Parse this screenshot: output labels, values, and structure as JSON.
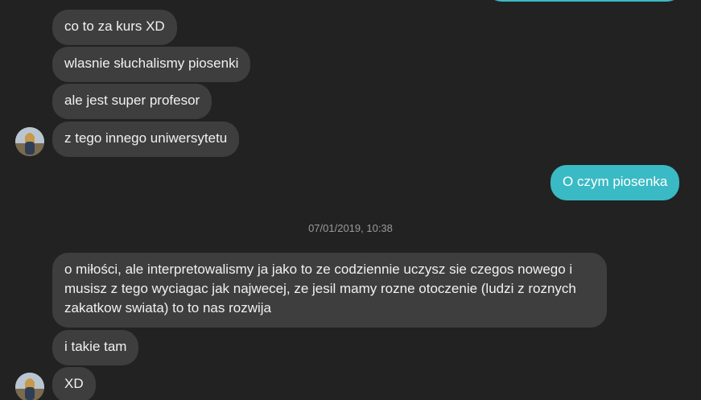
{
  "conversation": {
    "received": [
      "co to za kurs XD",
      "wlasnie słuchalismy piosenki",
      "ale jest super profesor",
      "z tego innego uniwersytetu"
    ],
    "sent": [
      "O czym piosenka"
    ],
    "timestamp": "07/01/2019, 10:38",
    "received_after": [
      "o miłości, ale interpretowalismy ja jako to ze codziennie uczysz sie czegos nowego i musisz z tego wyciagac jak najwecej, ze jesil mamy rozne otoczenie (ludzi z roznych zakatkow swiata) to to nas rozwija",
      "i takie tam",
      "XD"
    ]
  },
  "colors": {
    "background": "#222222",
    "incoming_bubble": "#3e3e3e",
    "outgoing_bubble": "#3abac4",
    "timestamp_text": "#9a9a9a"
  },
  "icons": [
    "contact-avatar",
    "contact-avatar"
  ]
}
